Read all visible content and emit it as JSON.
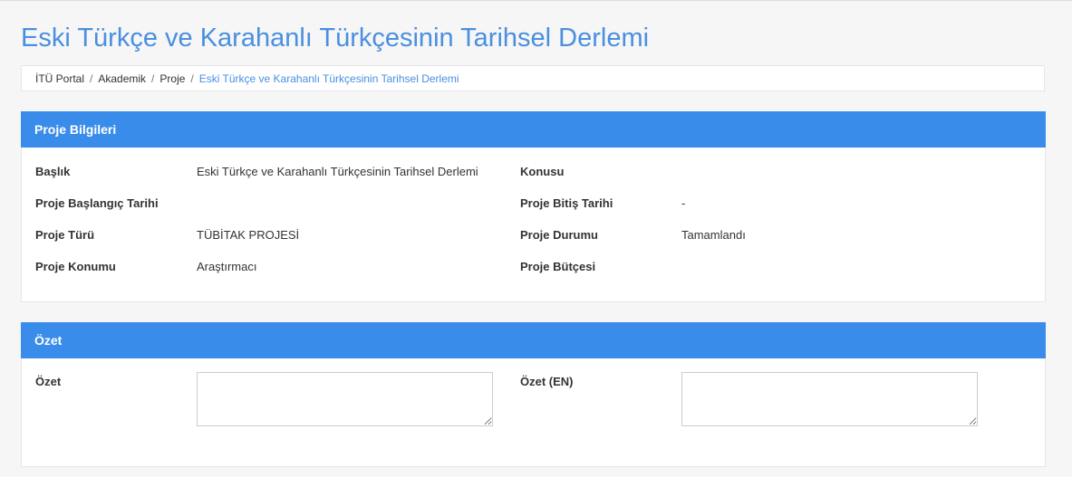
{
  "page": {
    "title": "Eski Türkçe ve Karahanlı Türkçesinin Tarihsel Derlemi"
  },
  "breadcrumb": {
    "items": [
      "İTÜ Portal",
      "Akademik",
      "Proje"
    ],
    "separator": "/",
    "active": "Eski Türkçe ve Karahanlı Türkçesinin Tarihsel Derlemi"
  },
  "project_info": {
    "heading": "Proje Bilgileri",
    "fields": {
      "title": {
        "label": "Başlık",
        "value": "Eski Türkçe ve Karahanlı Türkçesinin Tarihsel Derlemi"
      },
      "subject": {
        "label": "Konusu",
        "value": ""
      },
      "start_date": {
        "label": "Proje Başlangıç Tarihi",
        "value": ""
      },
      "end_date": {
        "label": "Proje Bitiş Tarihi",
        "value": "-"
      },
      "type": {
        "label": "Proje Türü",
        "value": "TÜBİTAK PROJESİ"
      },
      "status": {
        "label": "Proje Durumu",
        "value": "Tamamlandı"
      },
      "position": {
        "label": "Proje Konumu",
        "value": "Araştırmacı"
      },
      "budget": {
        "label": "Proje Bütçesi",
        "value": ""
      }
    }
  },
  "summary": {
    "heading": "Özet",
    "tr_label": "Özet",
    "tr_value": "",
    "en_label": "Özet (EN)",
    "en_value": ""
  },
  "colors": {
    "accent": "#3a8cea",
    "title": "#4a8fe0",
    "background": "#f6f6f6"
  }
}
